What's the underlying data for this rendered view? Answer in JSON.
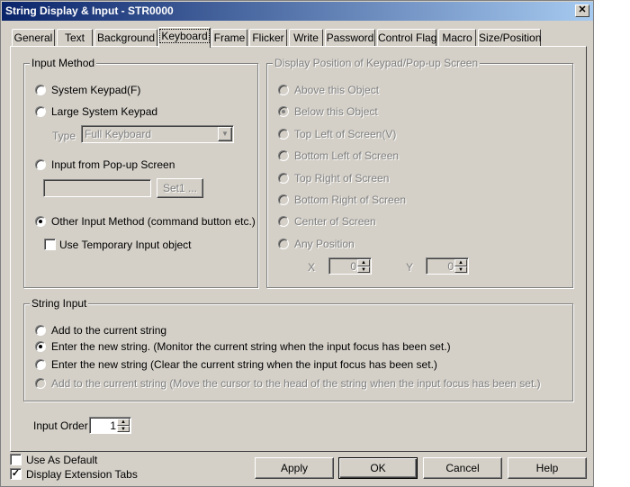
{
  "window": {
    "title": "String Display & Input - STR0000",
    "close_glyph": "✕"
  },
  "tabs": [
    {
      "label": "General"
    },
    {
      "label": "Text"
    },
    {
      "label": "Background"
    },
    {
      "label": "Keyboard"
    },
    {
      "label": "Frame"
    },
    {
      "label": "Flicker"
    },
    {
      "label": "Write"
    },
    {
      "label": "Password"
    },
    {
      "label": "Control Flag"
    },
    {
      "label": "Macro"
    },
    {
      "label": "Size/Position"
    }
  ],
  "input_method": {
    "title": "Input Method",
    "system_keypad": "System Keypad(F)",
    "large_system_keypad": "Large System Keypad",
    "type_label": "Type",
    "type_value": "Full Keyboard",
    "input_from_popup": "Input from Pop-up Screen",
    "popup_field_value": "",
    "set_button": "Set1 ...",
    "other_input_method": "Other Input Method (command button etc.)",
    "use_temporary": "Use Temporary Input object"
  },
  "display_position": {
    "title": "Display Position of Keypad/Pop-up Screen",
    "options": [
      "Above this Object",
      "Below this Object",
      "Top Left of Screen(V)",
      "Bottom Left of Screen",
      "Top Right of Screen",
      "Bottom Right of Screen",
      "Center of Screen",
      "Any Position"
    ],
    "x_label": "X",
    "x_value": "0",
    "y_label": "Y",
    "y_value": "0"
  },
  "string_input": {
    "title": "String Input",
    "options": [
      "Add to the current string",
      "Enter the new string. (Monitor the current string when the input focus has been set.)",
      "Enter the new string (Clear the current string when the input focus has been set.)",
      "Add to the current string (Move the cursor to the head of the string when the input focus has been set.)"
    ]
  },
  "input_order": {
    "label": "Input Order",
    "value": "1"
  },
  "footer": {
    "use_as_default": "Use As Default",
    "display_extension_tabs": "Display Extension Tabs",
    "apply": "Apply",
    "ok": "OK",
    "cancel": "Cancel",
    "help": "Help"
  }
}
